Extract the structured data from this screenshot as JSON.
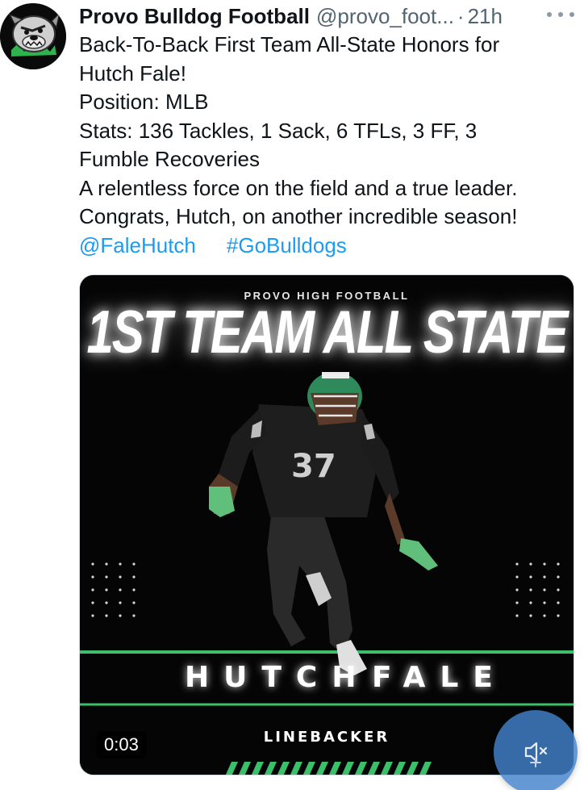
{
  "tweet": {
    "author_name": "Provo Bulldog Football",
    "handle": "@provo_foot...",
    "separator": "·",
    "time": "21h",
    "lines": [
      "Back-To-Back First Team All-State Honors for",
      "Hutch Fale!",
      "Position: MLB",
      "Stats: 136 Tackles, 1 Sack, 6 TFLs, 3 FF, 3",
      "Fumble Recoveries",
      "A relentless force on the field and a true leader.",
      "Congrats, Hutch, on another incredible season!"
    ],
    "mention": "@FaleHutch",
    "hashtag": "#GoBulldogs"
  },
  "media": {
    "eyebrow": "PROVO HIGH FOOTBALL",
    "headline": "1ST TEAM ALL STATE",
    "first_name": "HUTCH",
    "last_name": "FALE",
    "position": "LINEBACKER",
    "jersey_number": "37",
    "duration": "0:03"
  },
  "icons": {
    "avatar": "bulldog-logo-icon",
    "more": "more-options-icon",
    "mute": "speaker-muted-icon"
  },
  "colors": {
    "link": "#1d9bf0",
    "accent_green": "#3bbf6b",
    "media_bg": "#050505",
    "mute_button": "#4282cd"
  }
}
